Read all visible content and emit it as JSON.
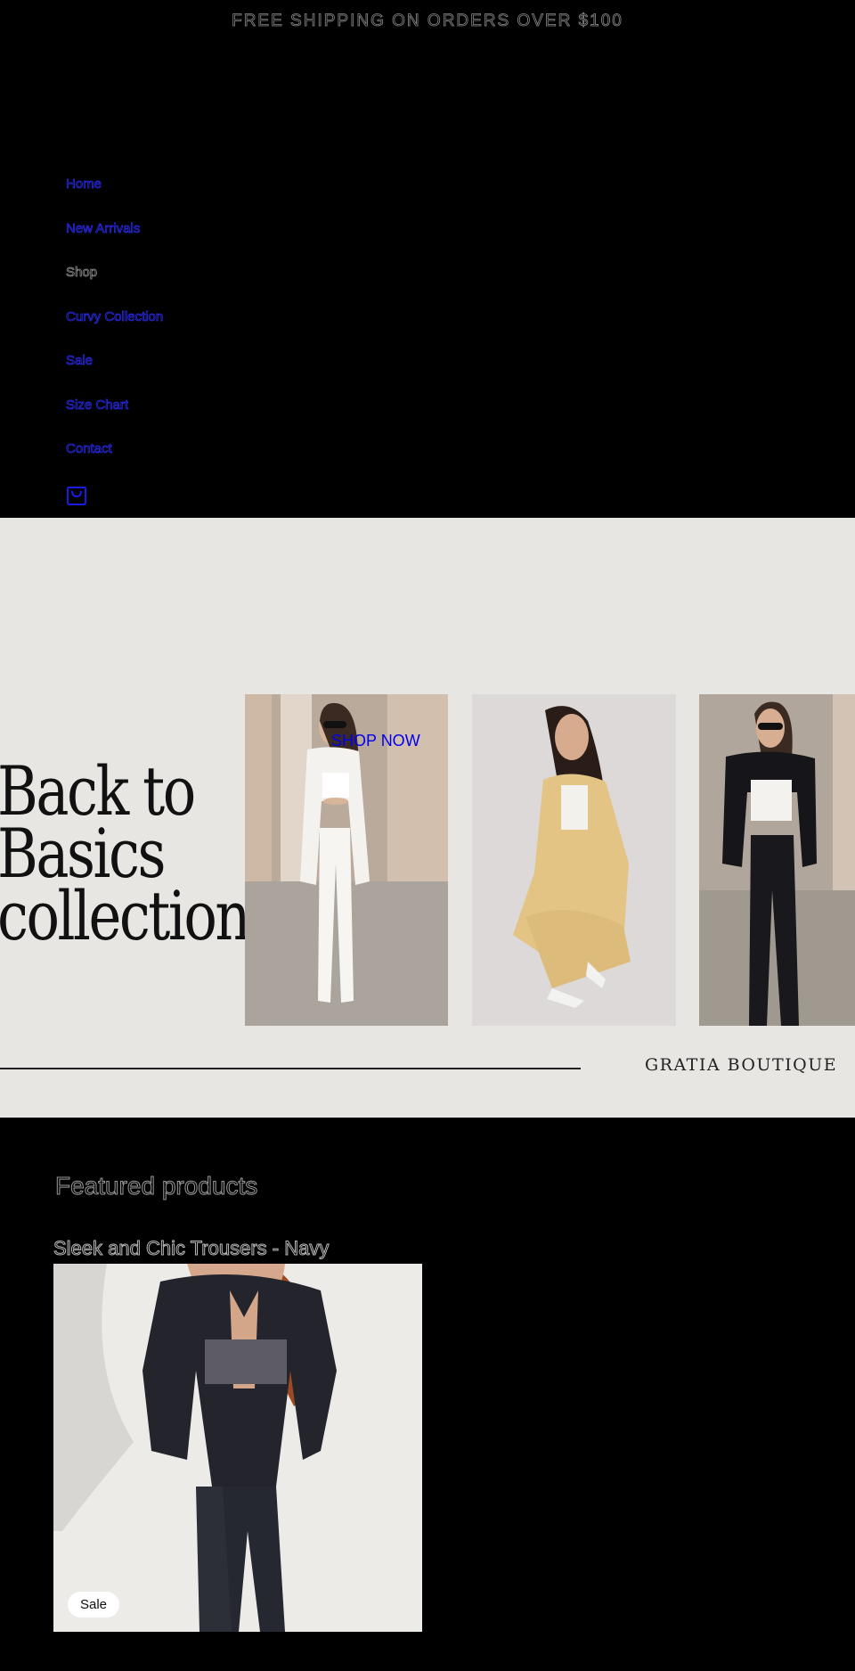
{
  "announcement": "FREE SHIPPING ON ORDERS OVER $100",
  "nav": {
    "items": [
      {
        "label": "Home"
      },
      {
        "label": "New Arrivals"
      },
      {
        "label": "Shop"
      },
      {
        "label": "Curvy Collection"
      },
      {
        "label": "Sale"
      },
      {
        "label": "Size Chart"
      },
      {
        "label": "Contact"
      }
    ],
    "cart_icon": "bag-icon"
  },
  "hero": {
    "title_lines": [
      "Back to",
      "Basics",
      "collection"
    ],
    "cta": "SHOP NOW",
    "brand": "GRATIA BOUTIQUE",
    "background": "#e8e6e3"
  },
  "featured": {
    "heading": "Featured products",
    "product": {
      "title": "Sleek and Chic Trousers - Navy",
      "badge": "Sale"
    }
  },
  "colors": {
    "link": "#0000ee",
    "page_bg": "#000000"
  }
}
